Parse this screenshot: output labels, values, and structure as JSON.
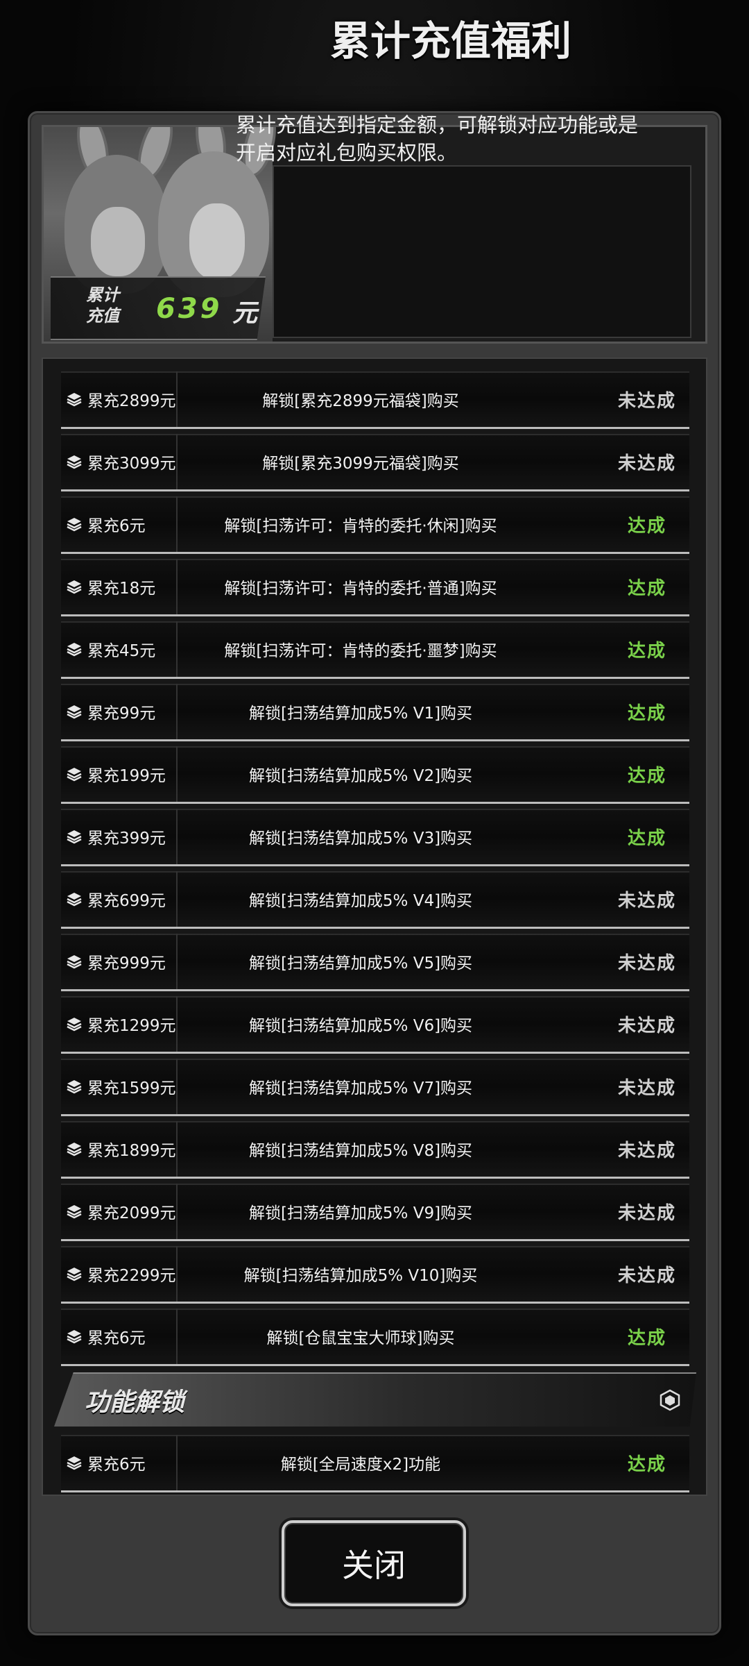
{
  "header": {
    "title": "累计充值福利",
    "description": "累计充值达到指定金额，可解锁对应功能或是开启对应礼包购买权限。",
    "total_label": "累计\n充值",
    "total_value": "639",
    "total_unit": "元"
  },
  "rows": [
    {
      "cond": "累充2899元",
      "reward": "解锁[累充2899元福袋]购买",
      "status": "未达成",
      "achieved": false
    },
    {
      "cond": "累充3099元",
      "reward": "解锁[累充3099元福袋]购买",
      "status": "未达成",
      "achieved": false
    },
    {
      "cond": "累充6元",
      "reward": "解锁[扫荡许可：肯特的委托·休闲]购买",
      "status": "达成",
      "achieved": true
    },
    {
      "cond": "累充18元",
      "reward": "解锁[扫荡许可：肯特的委托·普通]购买",
      "status": "达成",
      "achieved": true
    },
    {
      "cond": "累充45元",
      "reward": "解锁[扫荡许可：肯特的委托·噩梦]购买",
      "status": "达成",
      "achieved": true
    },
    {
      "cond": "累充99元",
      "reward": "解锁[扫荡结算加成5% V1]购买",
      "status": "达成",
      "achieved": true
    },
    {
      "cond": "累充199元",
      "reward": "解锁[扫荡结算加成5% V2]购买",
      "status": "达成",
      "achieved": true
    },
    {
      "cond": "累充399元",
      "reward": "解锁[扫荡结算加成5% V3]购买",
      "status": "达成",
      "achieved": true
    },
    {
      "cond": "累充699元",
      "reward": "解锁[扫荡结算加成5% V4]购买",
      "status": "未达成",
      "achieved": false
    },
    {
      "cond": "累充999元",
      "reward": "解锁[扫荡结算加成5% V5]购买",
      "status": "未达成",
      "achieved": false
    },
    {
      "cond": "累充1299元",
      "reward": "解锁[扫荡结算加成5% V6]购买",
      "status": "未达成",
      "achieved": false
    },
    {
      "cond": "累充1599元",
      "reward": "解锁[扫荡结算加成5% V7]购买",
      "status": "未达成",
      "achieved": false
    },
    {
      "cond": "累充1899元",
      "reward": "解锁[扫荡结算加成5% V8]购买",
      "status": "未达成",
      "achieved": false
    },
    {
      "cond": "累充2099元",
      "reward": "解锁[扫荡结算加成5% V9]购买",
      "status": "未达成",
      "achieved": false
    },
    {
      "cond": "累充2299元",
      "reward": "解锁[扫荡结算加成5% V10]购买",
      "status": "未达成",
      "achieved": false
    },
    {
      "cond": "累充6元",
      "reward": "解锁[仓鼠宝宝大师球]购买",
      "status": "达成",
      "achieved": true
    }
  ],
  "section": {
    "title": "功能解锁",
    "icon": "hexagon-icon"
  },
  "section_rows": [
    {
      "cond": "累充6元",
      "reward": "解锁[全局速度x2]功能",
      "status": "达成",
      "achieved": true
    }
  ],
  "close_button": "关闭",
  "colors": {
    "achieved": "#7ad14a",
    "not_achieved": "#d0d0d0",
    "total_value": "#8fd94a"
  },
  "icons": {
    "row_icon": "layers-icon"
  }
}
